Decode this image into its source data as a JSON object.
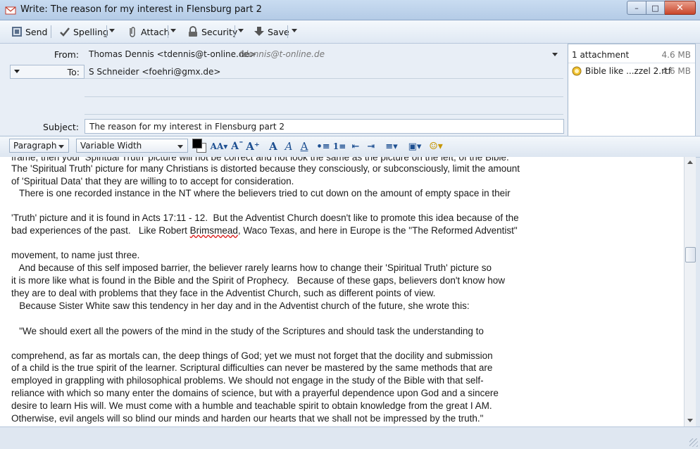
{
  "window": {
    "title": "Write: The reason for my interest in Flensburg part 2"
  },
  "toolbar": {
    "send": "Send",
    "spelling": "Spelling",
    "attach": "Attach",
    "security": "Security",
    "save": "Save"
  },
  "headers": {
    "from_label": "From:",
    "from_value": "Thomas Dennis <tdennis@t-online.de>",
    "from_identity": "tdennis@t-online.de",
    "to_label": "To:",
    "to_value": "S Schneider <foehri@gmx.de>",
    "subject_label": "Subject:",
    "subject_value": "The reason for my interest in Flensburg part 2"
  },
  "attachments": {
    "header": "1 attachment",
    "total_size": "4.6 MB",
    "items": [
      {
        "name": "Bible like ...zzel 2.rtf",
        "size": "4.6 MB"
      }
    ]
  },
  "format": {
    "paragraph": "Paragraph",
    "font": "Variable Width"
  },
  "body": {
    "lines": [
      "frame, then your 'Spiritual Truth' picture will not be correct and not look the same as the picture on the left, of the Bible.",
      "The 'Spiritual Truth' picture for many Christians is distorted because they consciously, or subconsciously, limit the amount",
      "of 'Spiritual Data' that they are willing to to accept for consideration.",
      "   There is one recorded instance in the NT where the believers tried to cut down on the amount of empty space in their",
      "",
      "'Truth' picture and it is found in Acts 17:11 - 12.  But the Adventist Church doesn't like to promote this idea because of the",
      "bad experiences of the past.   Like Robert Brimsmead, Waco Texas, and here in Europe is the \"The Reformed Adventist\"",
      "",
      "movement, to name just three.",
      "   And because of this self imposed barrier, the believer rarely learns how to change their 'Spiritual Truth' picture so",
      "it is more like what is found in the Bible and the Spirit of Prophecy.   Because of these gaps, believers don't know how",
      "they are to deal with problems that they face in the Adventist Church, such as different points of view.",
      "   Because Sister White saw this tendency in her day and in the Adventist church of the future, she wrote this:",
      "",
      "   \"We should exert all the powers of the mind in the study of the Scriptures and should task the understanding to",
      "",
      "comprehend, as far as mortals can, the deep things of God; yet we must not forget that the docility and submission",
      "of a child is the true spirit of the learner. Scriptural difficulties can never be mastered by the same methods that are",
      "employed in grappling with philosophical problems. We should not engage in the study of the Bible with that self-",
      "reliance with which so many enter the domains of science, but with a prayerful dependence upon God and a sincere",
      "desire to learn His will. We must come with a humble and teachable spirit to obtain knowledge from the great I AM.",
      "Otherwise, evil angels will so blind our minds and harden our hearts that we shall not be impressed by the truth.\""
    ]
  },
  "colors": {
    "text_color": "#000000",
    "background_color": "#ffffff"
  }
}
